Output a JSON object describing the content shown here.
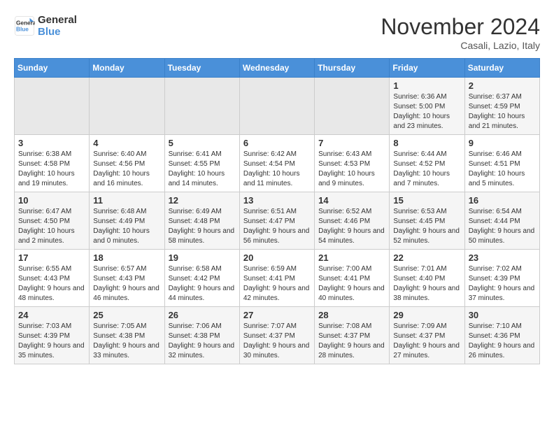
{
  "header": {
    "logo_line1": "General",
    "logo_line2": "Blue",
    "month_title": "November 2024",
    "location": "Casali, Lazio, Italy"
  },
  "weekdays": [
    "Sunday",
    "Monday",
    "Tuesday",
    "Wednesday",
    "Thursday",
    "Friday",
    "Saturday"
  ],
  "weeks": [
    [
      {
        "day": "",
        "info": ""
      },
      {
        "day": "",
        "info": ""
      },
      {
        "day": "",
        "info": ""
      },
      {
        "day": "",
        "info": ""
      },
      {
        "day": "",
        "info": ""
      },
      {
        "day": "1",
        "info": "Sunrise: 6:36 AM\nSunset: 5:00 PM\nDaylight: 10 hours and 23 minutes."
      },
      {
        "day": "2",
        "info": "Sunrise: 6:37 AM\nSunset: 4:59 PM\nDaylight: 10 hours and 21 minutes."
      }
    ],
    [
      {
        "day": "3",
        "info": "Sunrise: 6:38 AM\nSunset: 4:58 PM\nDaylight: 10 hours and 19 minutes."
      },
      {
        "day": "4",
        "info": "Sunrise: 6:40 AM\nSunset: 4:56 PM\nDaylight: 10 hours and 16 minutes."
      },
      {
        "day": "5",
        "info": "Sunrise: 6:41 AM\nSunset: 4:55 PM\nDaylight: 10 hours and 14 minutes."
      },
      {
        "day": "6",
        "info": "Sunrise: 6:42 AM\nSunset: 4:54 PM\nDaylight: 10 hours and 11 minutes."
      },
      {
        "day": "7",
        "info": "Sunrise: 6:43 AM\nSunset: 4:53 PM\nDaylight: 10 hours and 9 minutes."
      },
      {
        "day": "8",
        "info": "Sunrise: 6:44 AM\nSunset: 4:52 PM\nDaylight: 10 hours and 7 minutes."
      },
      {
        "day": "9",
        "info": "Sunrise: 6:46 AM\nSunset: 4:51 PM\nDaylight: 10 hours and 5 minutes."
      }
    ],
    [
      {
        "day": "10",
        "info": "Sunrise: 6:47 AM\nSunset: 4:50 PM\nDaylight: 10 hours and 2 minutes."
      },
      {
        "day": "11",
        "info": "Sunrise: 6:48 AM\nSunset: 4:49 PM\nDaylight: 10 hours and 0 minutes."
      },
      {
        "day": "12",
        "info": "Sunrise: 6:49 AM\nSunset: 4:48 PM\nDaylight: 9 hours and 58 minutes."
      },
      {
        "day": "13",
        "info": "Sunrise: 6:51 AM\nSunset: 4:47 PM\nDaylight: 9 hours and 56 minutes."
      },
      {
        "day": "14",
        "info": "Sunrise: 6:52 AM\nSunset: 4:46 PM\nDaylight: 9 hours and 54 minutes."
      },
      {
        "day": "15",
        "info": "Sunrise: 6:53 AM\nSunset: 4:45 PM\nDaylight: 9 hours and 52 minutes."
      },
      {
        "day": "16",
        "info": "Sunrise: 6:54 AM\nSunset: 4:44 PM\nDaylight: 9 hours and 50 minutes."
      }
    ],
    [
      {
        "day": "17",
        "info": "Sunrise: 6:55 AM\nSunset: 4:43 PM\nDaylight: 9 hours and 48 minutes."
      },
      {
        "day": "18",
        "info": "Sunrise: 6:57 AM\nSunset: 4:43 PM\nDaylight: 9 hours and 46 minutes."
      },
      {
        "day": "19",
        "info": "Sunrise: 6:58 AM\nSunset: 4:42 PM\nDaylight: 9 hours and 44 minutes."
      },
      {
        "day": "20",
        "info": "Sunrise: 6:59 AM\nSunset: 4:41 PM\nDaylight: 9 hours and 42 minutes."
      },
      {
        "day": "21",
        "info": "Sunrise: 7:00 AM\nSunset: 4:41 PM\nDaylight: 9 hours and 40 minutes."
      },
      {
        "day": "22",
        "info": "Sunrise: 7:01 AM\nSunset: 4:40 PM\nDaylight: 9 hours and 38 minutes."
      },
      {
        "day": "23",
        "info": "Sunrise: 7:02 AM\nSunset: 4:39 PM\nDaylight: 9 hours and 37 minutes."
      }
    ],
    [
      {
        "day": "24",
        "info": "Sunrise: 7:03 AM\nSunset: 4:39 PM\nDaylight: 9 hours and 35 minutes."
      },
      {
        "day": "25",
        "info": "Sunrise: 7:05 AM\nSunset: 4:38 PM\nDaylight: 9 hours and 33 minutes."
      },
      {
        "day": "26",
        "info": "Sunrise: 7:06 AM\nSunset: 4:38 PM\nDaylight: 9 hours and 32 minutes."
      },
      {
        "day": "27",
        "info": "Sunrise: 7:07 AM\nSunset: 4:37 PM\nDaylight: 9 hours and 30 minutes."
      },
      {
        "day": "28",
        "info": "Sunrise: 7:08 AM\nSunset: 4:37 PM\nDaylight: 9 hours and 28 minutes."
      },
      {
        "day": "29",
        "info": "Sunrise: 7:09 AM\nSunset: 4:37 PM\nDaylight: 9 hours and 27 minutes."
      },
      {
        "day": "30",
        "info": "Sunrise: 7:10 AM\nSunset: 4:36 PM\nDaylight: 9 hours and 26 minutes."
      }
    ]
  ]
}
